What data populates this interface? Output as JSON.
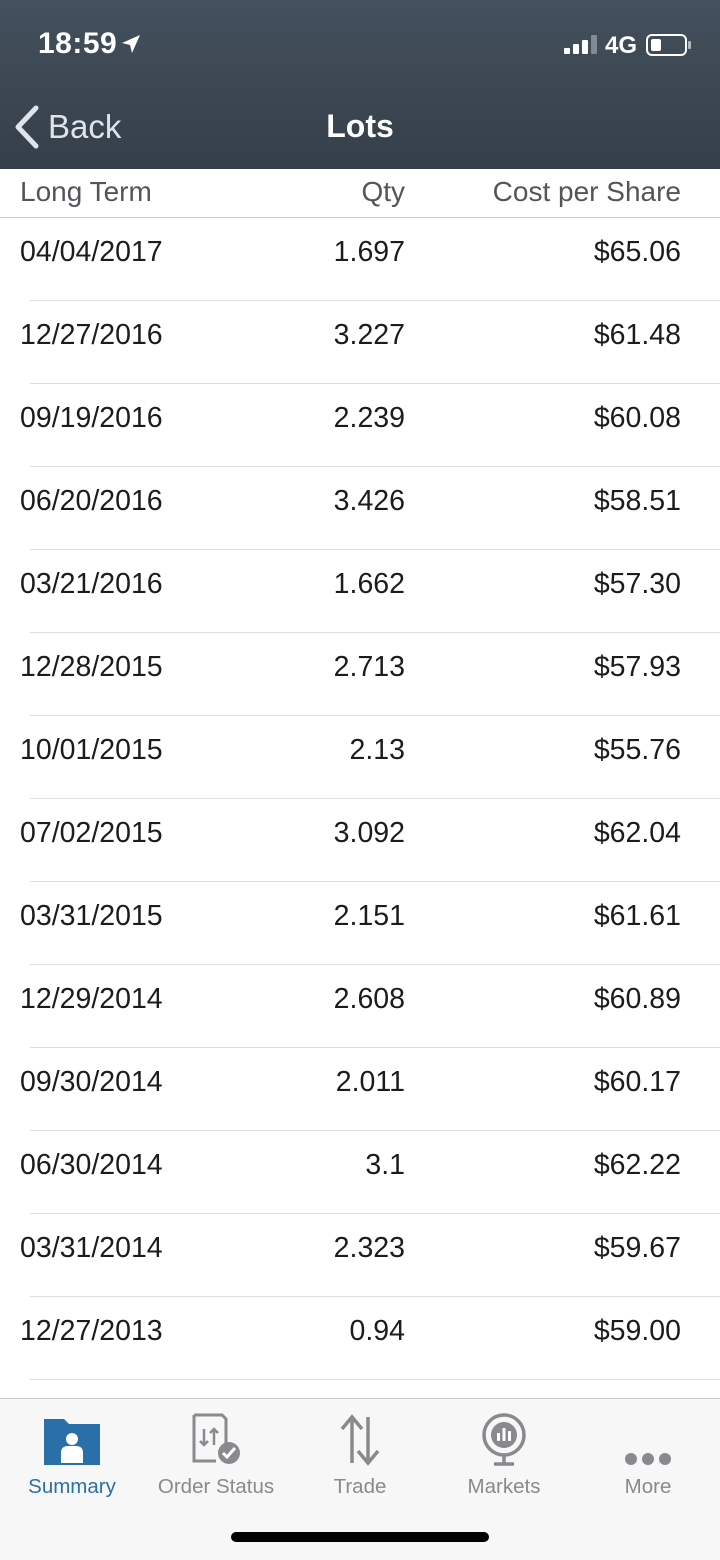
{
  "status_bar": {
    "time": "18:59",
    "network": "4G",
    "location_icon": "location-arrow-icon",
    "battery_icon": "battery-low-icon"
  },
  "nav": {
    "back_label": "Back",
    "title": "Lots"
  },
  "columns": {
    "term": "Long Term",
    "qty": "Qty",
    "cost": "Cost per Share"
  },
  "lots": [
    {
      "date": "04/04/2017",
      "qty": "1.697",
      "cost": "$65.06"
    },
    {
      "date": "12/27/2016",
      "qty": "3.227",
      "cost": "$61.48"
    },
    {
      "date": "09/19/2016",
      "qty": "2.239",
      "cost": "$60.08"
    },
    {
      "date": "06/20/2016",
      "qty": "3.426",
      "cost": "$58.51"
    },
    {
      "date": "03/21/2016",
      "qty": "1.662",
      "cost": "$57.30"
    },
    {
      "date": "12/28/2015",
      "qty": "2.713",
      "cost": "$57.93"
    },
    {
      "date": "10/01/2015",
      "qty": "2.13",
      "cost": "$55.76"
    },
    {
      "date": "07/02/2015",
      "qty": "3.092",
      "cost": "$62.04"
    },
    {
      "date": "03/31/2015",
      "qty": "2.151",
      "cost": "$61.61"
    },
    {
      "date": "12/29/2014",
      "qty": "2.608",
      "cost": "$60.89"
    },
    {
      "date": "09/30/2014",
      "qty": "2.011",
      "cost": "$60.17"
    },
    {
      "date": "06/30/2014",
      "qty": "3.1",
      "cost": "$62.22"
    },
    {
      "date": "03/31/2014",
      "qty": "2.323",
      "cost": "$59.67"
    },
    {
      "date": "12/27/2013",
      "qty": "0.94",
      "cost": "$59.00"
    }
  ],
  "tabs": [
    {
      "label": "Summary",
      "icon": "summary-folder-icon",
      "active": true
    },
    {
      "label": "Order Status",
      "icon": "order-status-icon",
      "active": false
    },
    {
      "label": "Trade",
      "icon": "trade-arrows-icon",
      "active": false
    },
    {
      "label": "Markets",
      "icon": "markets-globe-icon",
      "active": false
    },
    {
      "label": "More",
      "icon": "more-dots-icon",
      "active": false
    }
  ],
  "colors": {
    "header_bg": "#3d4855",
    "active_tab": "#2b6fa8",
    "inactive_tab": "#8a8a8e"
  }
}
